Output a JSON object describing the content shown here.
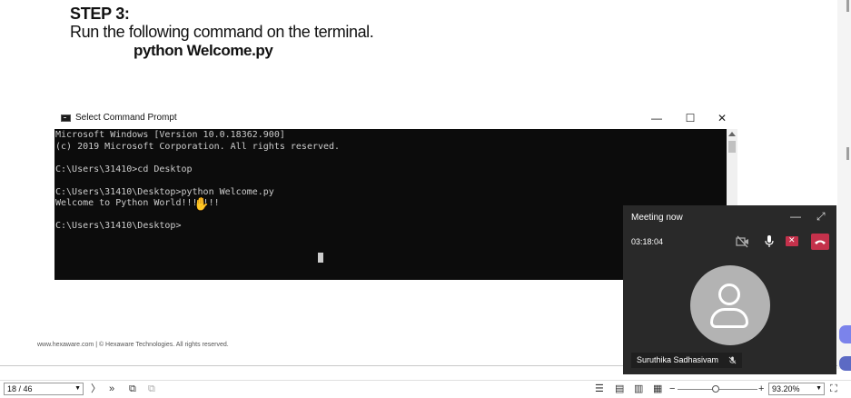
{
  "document": {
    "step_title": "STEP 3:",
    "step_text": "Run the following command on the terminal.",
    "step_command": "python Welcome.py",
    "footer": "www.hexaware.com | © Hexaware Technologies. All rights reserved."
  },
  "cmd_window": {
    "title": "Select Command Prompt",
    "minimize_glyph": "—",
    "maximize_glyph": "☐",
    "close_glyph": "✕",
    "lines": [
      "Microsoft Windows [Version 10.0.18362.900]",
      "(c) 2019 Microsoft Corporation. All rights reserved.",
      "",
      "C:\\Users\\31410>cd Desktop",
      "",
      "C:\\Users\\31410\\Desktop>python Welcome.py",
      "Welcome to Python World!!!!!!!",
      "",
      "C:\\Users\\31410\\Desktop>"
    ]
  },
  "meeting": {
    "title": "Meeting now",
    "timer": "03:18:04",
    "participant_name": "Suruthika Sadhasivam",
    "icons": [
      "camera-off-icon",
      "microphone-icon",
      "share-tray-icon",
      "hang-up-icon",
      "minimize-icon",
      "expand-icon",
      "mic-muted-icon",
      "avatar-person-icon"
    ],
    "accent_red": "#c4314b"
  },
  "statusbar": {
    "page_indicator": "18 / 46",
    "zoom_value": "93.20%",
    "zoom_level": 0.44,
    "zoom_minus": "−",
    "zoom_plus": "+"
  }
}
